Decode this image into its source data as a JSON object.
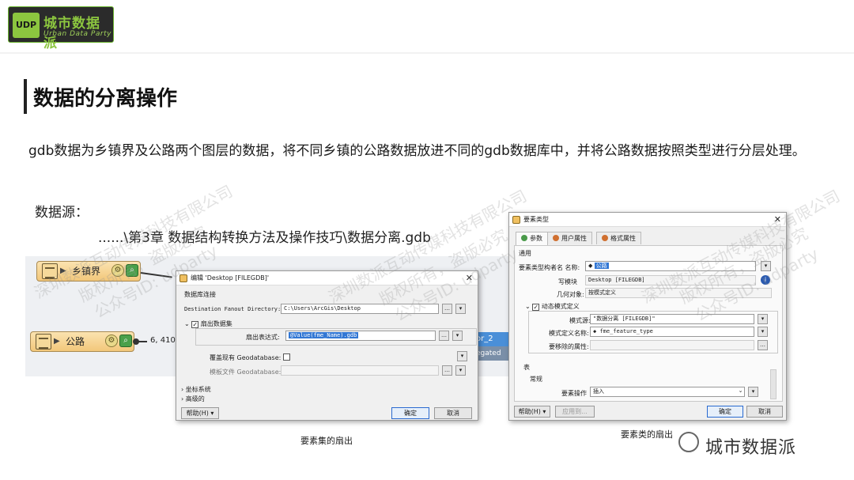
{
  "logo": {
    "badge": "UDP",
    "name": "城市数据派",
    "subtitle": "Urban Data Party"
  },
  "slide": {
    "title": "数据的分离操作",
    "description": "gdb数据为乡镇界及公路两个图层的数据，将不同乡镇的公路数据放进不同的gdb数据库中，并将公路数据按照类型进行分层处理。",
    "source_label": "数据源：",
    "source_path": "......\\第3章 数据结构转换方法及操作技巧\\数据分离.gdb"
  },
  "workspace": {
    "feature1": "乡镇界",
    "feature2": "公路",
    "feature2_count": "6, 410",
    "stub1": "or_2",
    "stub2": "egated"
  },
  "dialog1": {
    "title": "编辑 'Desktop [FILEGDB]'",
    "group_db": "数据库连接",
    "dest_label": "Destination Fanout Directory:",
    "dest_value": "C:\\Users\\ArcGis\\Desktop",
    "fanout_group": "扇出数据集",
    "fanout_expr_label": "扇出表达式:",
    "fanout_expr_value": "@Value(fme_Name).gdb",
    "overwrite_label": "覆盖现有 Geodatabase:",
    "template_label": "模板文件 Geodatabase:",
    "coord": "坐标系统",
    "advanced": "高级的",
    "help": "帮助(H)",
    "ok": "确定",
    "cancel": "取消"
  },
  "dialog2": {
    "title": "要素类型",
    "tabs": [
      "参数",
      "用户属性",
      "格式属性"
    ],
    "general": "通用",
    "name_label": "要素类型构者名 名称:",
    "name_value": "公路",
    "writer_label": "写模块",
    "writer_value": "Desktop [FILEGDB]",
    "geom_label": "几何对象:",
    "geom_value": "按模式定义",
    "dyn_label": "动态模式定义",
    "schema_src_label": "模式源:",
    "schema_src_value": "\"数据分离 [FILEGDB]\"",
    "schema_def_label": "模式定义名称:",
    "schema_def_value": "fme_feature_type",
    "ignore_label": "要移除的属性:",
    "table_section": "表",
    "common": "常规",
    "op_label": "要素操作",
    "op_value": "插入",
    "help": "帮助(H)",
    "apply": "应用到...",
    "ok": "确定",
    "cancel": "取消"
  },
  "captions": {
    "left": "要素集的扇出",
    "right": "要素类的扇出"
  },
  "watermark": {
    "line1": "深圳数派互动传媒科技有限公司",
    "line2": "版权所有，盗版必究",
    "line3": "公众号ID: udparty"
  },
  "brand": "城市数据派"
}
